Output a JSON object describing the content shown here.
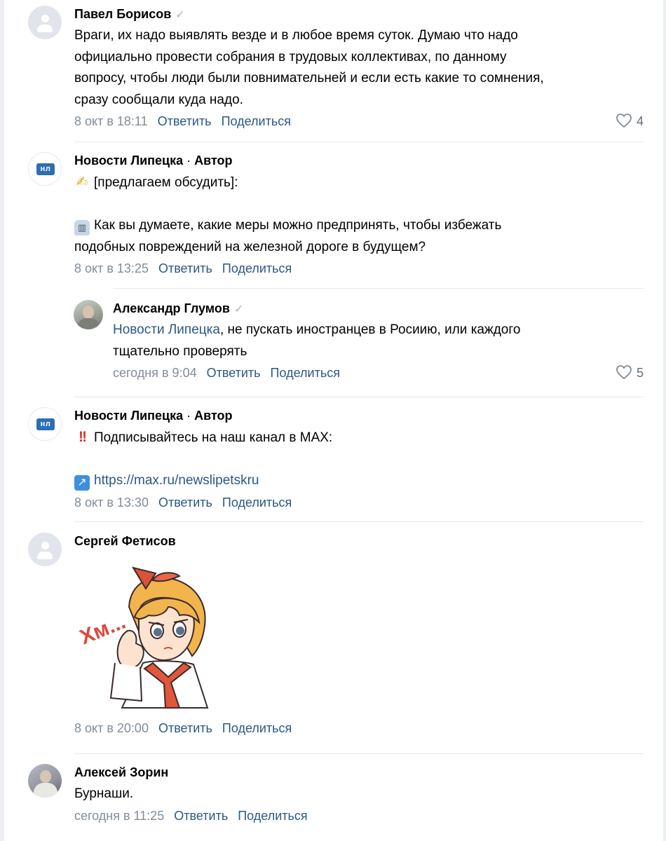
{
  "comments": [
    {
      "author": "Павел Борисов",
      "verified": true,
      "lines": [
        "Враги, их надо выявлять везде и в любое время суток. Думаю что надо",
        "официально провести собрания в трудовых коллективах, по данному",
        "вопросу, чтобы люди были повнимательней и если есть какие то сомнения,",
        "сразу сообщали куда надо."
      ],
      "date": "8 окт в 18:11",
      "reply_label": "Ответить",
      "share_label": "Поделиться",
      "likes": "4"
    },
    {
      "author": "Новости Липецка",
      "author_suffix": "Автор",
      "avatar_badge": "нл",
      "line1": "[предлагаем обсудить]:",
      "line2": "Как вы думаете, какие меры можно предпринять, чтобы избежать",
      "line3": "подобных повреждений на железной дороге в будущем?",
      "date": "8 окт в 13:25",
      "reply_label": "Ответить",
      "share_label": "Поделиться"
    },
    {
      "author": "Александр Глумов",
      "verified": true,
      "mention": "Новости Липецка",
      "text_after_mention": ", не пускать иностранцев в Росиию, или каждого",
      "line2": "тщательно проверять",
      "date": "сегодня в 9:04",
      "reply_label": "Ответить",
      "share_label": "Поделиться",
      "likes": "5"
    },
    {
      "author": "Новости Липецка",
      "author_suffix": "Автор",
      "avatar_badge": "нл",
      "line1": "Подписывайтесь на наш канал в MAX:",
      "link": "https://max.ru/newslipetskru",
      "date": "8 окт в 13:30",
      "reply_label": "Ответить",
      "share_label": "Поделиться"
    },
    {
      "author": "Сергей Фетисов",
      "sticker_text": "Хм...",
      "date": "8 окт в 20:00",
      "reply_label": "Ответить",
      "share_label": "Поделиться"
    },
    {
      "author": "Алексей Зорин",
      "text": "Бурнаши.",
      "date": "сегодня в 11:25",
      "reply_label": "Ответить",
      "share_label": "Поделиться"
    }
  ],
  "colors": {
    "link": "#2a5885",
    "meta": "#818c99",
    "divider": "#e7e8ec",
    "avatar_placeholder": "#e1e5eb"
  },
  "icons": [
    "person-placeholder-icon",
    "verified-check-icon",
    "heart-icon",
    "pin-emoji-icon",
    "train-emoji-icon",
    "double-exclamation-emoji-icon",
    "arrow-up-right-emoji-icon"
  ]
}
